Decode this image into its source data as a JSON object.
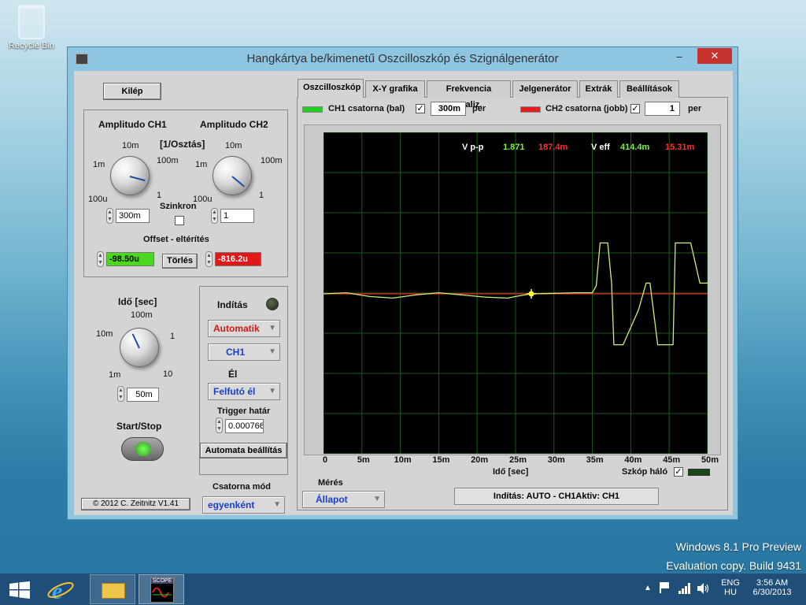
{
  "desktop": {
    "recycle_bin": "Recycle Bin"
  },
  "window": {
    "title": "Hangkártya be/kimenetű Oszcilloszkóp és Szignálgenerátor",
    "minimize": "–",
    "maximize": "□",
    "close": "✕"
  },
  "left": {
    "exit_button": "Kilép",
    "amp_ch1_title": "Amplitudo CH1",
    "amp_ch2_title": "Amplitudo CH2",
    "div_unit": "[1/Osztás]",
    "amp_ticks": {
      "t10m": "10m",
      "t1m": "1m",
      "t100m": "100m",
      "t100u": "100u",
      "t1": "1"
    },
    "ch1_amp_value": "300m",
    "ch2_amp_value": "1",
    "sync_label": "Szinkron",
    "offset_title": "Offset - eltérítés",
    "offset_ch1": "-98.50u",
    "offset_clear": "Törlés",
    "offset_ch2": "-816.2u",
    "time_title": "Idő [sec]",
    "time_ticks": {
      "t100m": "100m",
      "t10m": "10m",
      "t1": "1",
      "t1m": "1m",
      "t10": "10"
    },
    "time_value": "50m",
    "startstop_label": "Start/Stop",
    "copyright": "© 2012  C. Zeitnitz V1.41"
  },
  "trigger": {
    "title": "Indítás",
    "mode": "Automatik",
    "channel": "CH1",
    "edge_label": "Él",
    "edge": "Felfutó él",
    "level_label": "Trigger határ",
    "level_value": "0.000766",
    "auto_setup": "Automata beállítás",
    "channel_mode_label": "Csatorna mód",
    "channel_mode": "egyenként"
  },
  "tabs": [
    {
      "label": "Oszcilloszkóp"
    },
    {
      "label": "X-Y grafika"
    },
    {
      "label": "Frekvencia analiz."
    },
    {
      "label": "Jelgenerátor"
    },
    {
      "label": "Extrák"
    },
    {
      "label": "Beállítások"
    }
  ],
  "scope": {
    "ch1_label": "CH1 csatorna (bal)",
    "ch1_scale": "300m",
    "ch1_per": "per",
    "ch2_label": "CH2 csatorna (jobb)",
    "ch2_scale": "1",
    "ch2_per": "per",
    "ch1_color": "#22cc22",
    "ch2_color": "#e02020",
    "vpp_label": "V p-p",
    "vpp_ch1": "1.871",
    "vpp_ch2": "187.4m",
    "veff_label": "V eff",
    "veff_ch1": "414.4m",
    "veff_ch2": "15.31m",
    "x_ticks": [
      "0",
      "5m",
      "10m",
      "15m",
      "20m",
      "25m",
      "30m",
      "35m",
      "40m",
      "45m",
      "50m"
    ],
    "x_label": "Idő [sec]",
    "grid_label": "Szkóp háló",
    "meres_label": "Mérés",
    "meres_value": "Állapot",
    "status": "Indítás: AUTO - CH1Aktiv: CH1"
  },
  "chart_data": {
    "type": "line",
    "xlabel": "Idő [sec]",
    "xlim": [
      0,
      0.05
    ],
    "x_ticks": [
      "0",
      "5m",
      "10m",
      "15m",
      "20m",
      "25m",
      "30m",
      "35m",
      "40m",
      "45m",
      "50m"
    ],
    "grid": true,
    "series": [
      {
        "name": "CH1 csatorna (bal)",
        "color": "#c8f07a",
        "x": [
          0,
          0.003,
          0.006,
          0.009,
          0.012,
          0.015,
          0.018,
          0.021,
          0.024,
          0.025,
          0.027,
          0.03,
          0.033,
          0.035,
          0.0355,
          0.036,
          0.037,
          0.0375,
          0.0378,
          0.039,
          0.041,
          0.042,
          0.0425,
          0.0435,
          0.0455,
          0.0458,
          0.0478,
          0.049,
          0.05
        ],
        "y": [
          0.0,
          0.02,
          -0.05,
          -0.08,
          -0.02,
          0.02,
          -0.02,
          -0.06,
          -0.08,
          -0.05,
          0.0,
          0.01,
          0.02,
          0.02,
          0.15,
          0.95,
          0.95,
          0.2,
          -0.95,
          -0.95,
          -0.3,
          0.2,
          0.2,
          -0.95,
          -0.95,
          0.95,
          0.95,
          0.2,
          0.2
        ]
      },
      {
        "name": "CH2 csatorna (jobb)",
        "color": "#e02020",
        "x": [
          0,
          0.05
        ],
        "y": [
          0.0,
          0.0
        ]
      }
    ]
  },
  "taskbar": {
    "lang1": "ENG",
    "lang2": "HU",
    "time": "3:56 AM",
    "date": "6/30/2013",
    "scope_icon": "SCOPE"
  },
  "watermark": {
    "line1": "Windows 8.1 Pro Preview",
    "line2": "Evaluation copy. Build 9431"
  }
}
